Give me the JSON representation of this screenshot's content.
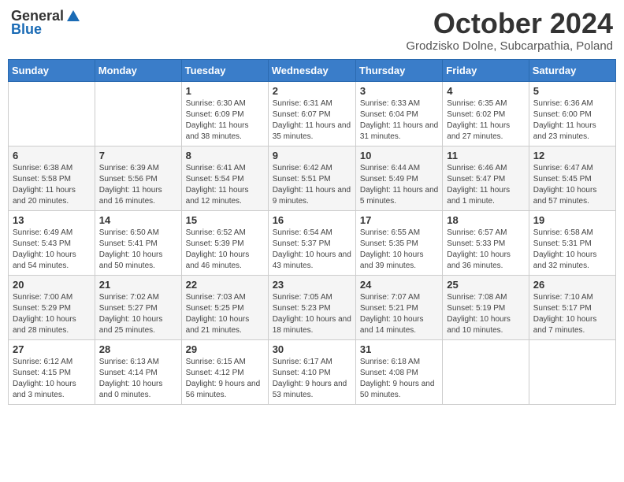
{
  "header": {
    "logo_general": "General",
    "logo_blue": "Blue",
    "month_title": "October 2024",
    "location": "Grodzisko Dolne, Subcarpathia, Poland"
  },
  "weekdays": [
    "Sunday",
    "Monday",
    "Tuesday",
    "Wednesday",
    "Thursday",
    "Friday",
    "Saturday"
  ],
  "weeks": [
    [
      {
        "day": "",
        "info": ""
      },
      {
        "day": "",
        "info": ""
      },
      {
        "day": "1",
        "info": "Sunrise: 6:30 AM\nSunset: 6:09 PM\nDaylight: 11 hours and 38 minutes."
      },
      {
        "day": "2",
        "info": "Sunrise: 6:31 AM\nSunset: 6:07 PM\nDaylight: 11 hours and 35 minutes."
      },
      {
        "day": "3",
        "info": "Sunrise: 6:33 AM\nSunset: 6:04 PM\nDaylight: 11 hours and 31 minutes."
      },
      {
        "day": "4",
        "info": "Sunrise: 6:35 AM\nSunset: 6:02 PM\nDaylight: 11 hours and 27 minutes."
      },
      {
        "day": "5",
        "info": "Sunrise: 6:36 AM\nSunset: 6:00 PM\nDaylight: 11 hours and 23 minutes."
      }
    ],
    [
      {
        "day": "6",
        "info": "Sunrise: 6:38 AM\nSunset: 5:58 PM\nDaylight: 11 hours and 20 minutes."
      },
      {
        "day": "7",
        "info": "Sunrise: 6:39 AM\nSunset: 5:56 PM\nDaylight: 11 hours and 16 minutes."
      },
      {
        "day": "8",
        "info": "Sunrise: 6:41 AM\nSunset: 5:54 PM\nDaylight: 11 hours and 12 minutes."
      },
      {
        "day": "9",
        "info": "Sunrise: 6:42 AM\nSunset: 5:51 PM\nDaylight: 11 hours and 9 minutes."
      },
      {
        "day": "10",
        "info": "Sunrise: 6:44 AM\nSunset: 5:49 PM\nDaylight: 11 hours and 5 minutes."
      },
      {
        "day": "11",
        "info": "Sunrise: 6:46 AM\nSunset: 5:47 PM\nDaylight: 11 hours and 1 minute."
      },
      {
        "day": "12",
        "info": "Sunrise: 6:47 AM\nSunset: 5:45 PM\nDaylight: 10 hours and 57 minutes."
      }
    ],
    [
      {
        "day": "13",
        "info": "Sunrise: 6:49 AM\nSunset: 5:43 PM\nDaylight: 10 hours and 54 minutes."
      },
      {
        "day": "14",
        "info": "Sunrise: 6:50 AM\nSunset: 5:41 PM\nDaylight: 10 hours and 50 minutes."
      },
      {
        "day": "15",
        "info": "Sunrise: 6:52 AM\nSunset: 5:39 PM\nDaylight: 10 hours and 46 minutes."
      },
      {
        "day": "16",
        "info": "Sunrise: 6:54 AM\nSunset: 5:37 PM\nDaylight: 10 hours and 43 minutes."
      },
      {
        "day": "17",
        "info": "Sunrise: 6:55 AM\nSunset: 5:35 PM\nDaylight: 10 hours and 39 minutes."
      },
      {
        "day": "18",
        "info": "Sunrise: 6:57 AM\nSunset: 5:33 PM\nDaylight: 10 hours and 36 minutes."
      },
      {
        "day": "19",
        "info": "Sunrise: 6:58 AM\nSunset: 5:31 PM\nDaylight: 10 hours and 32 minutes."
      }
    ],
    [
      {
        "day": "20",
        "info": "Sunrise: 7:00 AM\nSunset: 5:29 PM\nDaylight: 10 hours and 28 minutes."
      },
      {
        "day": "21",
        "info": "Sunrise: 7:02 AM\nSunset: 5:27 PM\nDaylight: 10 hours and 25 minutes."
      },
      {
        "day": "22",
        "info": "Sunrise: 7:03 AM\nSunset: 5:25 PM\nDaylight: 10 hours and 21 minutes."
      },
      {
        "day": "23",
        "info": "Sunrise: 7:05 AM\nSunset: 5:23 PM\nDaylight: 10 hours and 18 minutes."
      },
      {
        "day": "24",
        "info": "Sunrise: 7:07 AM\nSunset: 5:21 PM\nDaylight: 10 hours and 14 minutes."
      },
      {
        "day": "25",
        "info": "Sunrise: 7:08 AM\nSunset: 5:19 PM\nDaylight: 10 hours and 10 minutes."
      },
      {
        "day": "26",
        "info": "Sunrise: 7:10 AM\nSunset: 5:17 PM\nDaylight: 10 hours and 7 minutes."
      }
    ],
    [
      {
        "day": "27",
        "info": "Sunrise: 6:12 AM\nSunset: 4:15 PM\nDaylight: 10 hours and 3 minutes."
      },
      {
        "day": "28",
        "info": "Sunrise: 6:13 AM\nSunset: 4:14 PM\nDaylight: 10 hours and 0 minutes."
      },
      {
        "day": "29",
        "info": "Sunrise: 6:15 AM\nSunset: 4:12 PM\nDaylight: 9 hours and 56 minutes."
      },
      {
        "day": "30",
        "info": "Sunrise: 6:17 AM\nSunset: 4:10 PM\nDaylight: 9 hours and 53 minutes."
      },
      {
        "day": "31",
        "info": "Sunrise: 6:18 AM\nSunset: 4:08 PM\nDaylight: 9 hours and 50 minutes."
      },
      {
        "day": "",
        "info": ""
      },
      {
        "day": "",
        "info": ""
      }
    ]
  ]
}
